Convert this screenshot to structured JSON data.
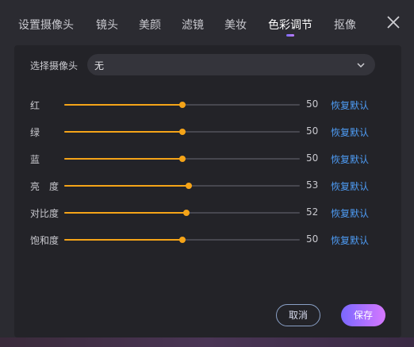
{
  "tabs": [
    {
      "label": "设置摄像头"
    },
    {
      "label": "镜头"
    },
    {
      "label": "美颜"
    },
    {
      "label": "滤镜"
    },
    {
      "label": "美妆"
    },
    {
      "label": "色彩调节"
    },
    {
      "label": "抠像"
    }
  ],
  "active_tab": "色彩调节",
  "camera": {
    "label": "选择摄像头",
    "value": "无"
  },
  "sliders": [
    {
      "label": "红",
      "value": 50,
      "max": 100,
      "value_text": "50",
      "reset": "恢复默认"
    },
    {
      "label": "绿",
      "value": 50,
      "max": 100,
      "value_text": "50",
      "reset": "恢复默认"
    },
    {
      "label": "蓝",
      "value": 50,
      "max": 100,
      "value_text": "50",
      "reset": "恢复默认"
    },
    {
      "label": "亮　度",
      "value": 53,
      "max": 100,
      "value_text": "53",
      "reset": "恢复默认"
    },
    {
      "label": "对比度",
      "value": 52,
      "max": 100,
      "value_text": "52",
      "reset": "恢复默认"
    },
    {
      "label": "饱和度",
      "value": 50,
      "max": 100,
      "value_text": "50",
      "reset": "恢复默认"
    }
  ],
  "buttons": {
    "cancel": "取消",
    "save": "保存"
  },
  "colors": {
    "accent": "#f5a418",
    "link": "#4e9cf5",
    "save_gradient_start": "#7a68ff",
    "save_gradient_end": "#d678ff"
  },
  "icons": {
    "close": "close-icon",
    "dropdown": "chevron-down-icon"
  }
}
